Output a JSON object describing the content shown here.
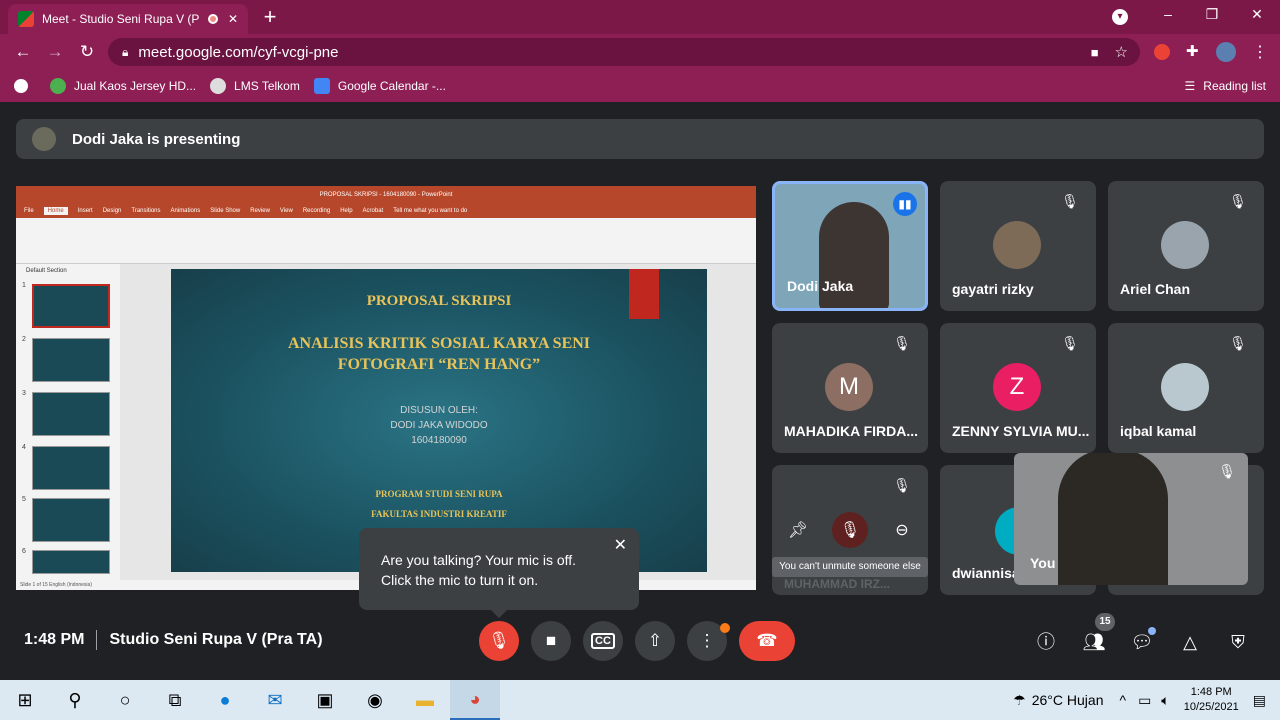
{
  "browser": {
    "tab_title": "Meet - Studio Seni Rupa V (P",
    "new_tab": "+",
    "url": "meet.google.com/cyf-vcgi-pne",
    "bookmarks": [
      "Jual Kaos Jersey HD...",
      "LMS Telkom",
      "Google Calendar -..."
    ],
    "reading_list": "Reading list",
    "colors": {
      "frame": "#7b1848",
      "toolbar": "#8e1f55"
    }
  },
  "meet": {
    "banner": "Dodi Jaka is presenting",
    "time": "1:48 PM",
    "meeting_name": "Studio Seni Rupa V (Pra TA)",
    "participants_count": "15",
    "popover": {
      "line1": "Are you talking? Your mic is off.",
      "line2": "Click the mic to turn it on."
    },
    "tiles": [
      {
        "name": "Dodi Jaka"
      },
      {
        "name": "gayatri rizky"
      },
      {
        "name": "Ariel Chan"
      },
      {
        "name": "MAHADIKA FIRDA...",
        "initial": "M",
        "color": "#8d6e63"
      },
      {
        "name": "ZENNY SYLVIA MU...",
        "initial": "Z",
        "color": "#e91e63"
      },
      {
        "name": "iqbal kamal"
      },
      {
        "name": "MUHAMMAD IRZ..."
      },
      {
        "name": "dwiannisa"
      }
    ],
    "self_name": "You",
    "unmute_tooltip": "You can't unmute someone else"
  },
  "slide": {
    "app_title": "PROPOSAL SKRIPSI - 1604180090 - PowerPoint",
    "ribbon_tabs": [
      "File",
      "Home",
      "Insert",
      "Design",
      "Transitions",
      "Animations",
      "Slide Show",
      "Review",
      "View",
      "Recording",
      "Help",
      "Acrobat",
      "Tell me what you want to do"
    ],
    "section": "Default Section",
    "title": "PROPOSAL SKRIPSI",
    "heading_line1": "ANALISIS KRITIK SOSIAL KARYA SENI",
    "heading_line2": "FOTOGRAFI “REN HANG”",
    "author_label": "DISUSUN OLEH:",
    "author": "DODI JAKA WIDODO",
    "nim": "1604180090",
    "program": "PROGRAM STUDI SENI RUPA",
    "faculty": "FAKULTAS INDUSTRI KREATIF",
    "status": "Slide 1 of 15   English (Indonesia)"
  },
  "taskbar": {
    "weather": "26°C  Hujan",
    "clock_time": "1:48 PM",
    "clock_date": "10/25/2021"
  }
}
